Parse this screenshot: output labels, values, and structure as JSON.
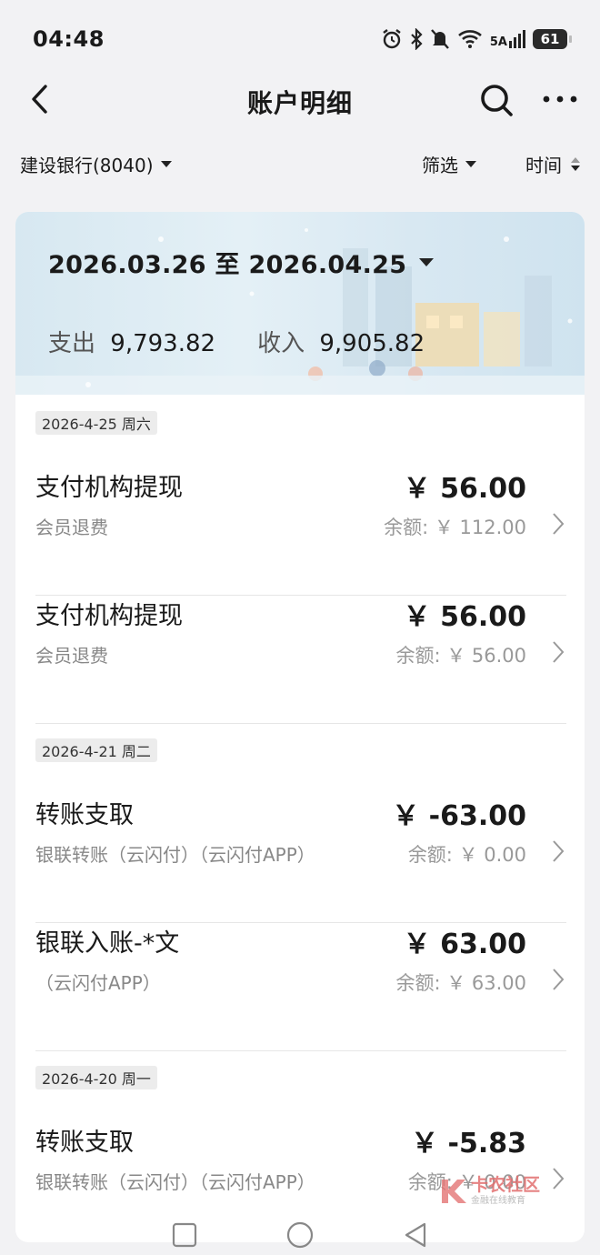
{
  "status_bar": {
    "time": "04:48",
    "signal_label": "5A",
    "battery": "61",
    "icons": [
      "alarm-icon",
      "bluetooth-icon",
      "mute-icon",
      "wifi-icon",
      "cell-signal-icon",
      "battery-icon"
    ]
  },
  "navbar": {
    "title": "账户明细",
    "icons": [
      "back-arrow-icon",
      "search-icon",
      "more-icon"
    ]
  },
  "filters": {
    "account": "建设银行(8040)",
    "filter": "筛选",
    "sort": "时间"
  },
  "summary": {
    "range": "2026.03.26 至 2026.04.25",
    "expense_label": "支出",
    "expense_value": "9,793.82",
    "income_label": "收入",
    "income_value": "9,905.82"
  },
  "groups": [
    {
      "date": "2026-4-25 周六",
      "items": [
        {
          "title": "支付机构提现",
          "desc": "会员退费",
          "amount": "￥ 56.00",
          "balance": "余额: ￥ 112.00"
        },
        {
          "title": "支付机构提现",
          "desc": "会员退费",
          "amount": "￥ 56.00",
          "balance": "余额: ￥ 56.00"
        }
      ]
    },
    {
      "date": "2026-4-21 周二",
      "items": [
        {
          "title": "转账支取",
          "desc": "银联转账（云闪付）（云闪付APP）",
          "amount": "￥ -63.00",
          "balance": "余额: ￥ 0.00"
        },
        {
          "title": "银联入账-*文",
          "desc": "（云闪付APP）",
          "amount": "￥ 63.00",
          "balance": "余额: ￥ 63.00"
        }
      ]
    },
    {
      "date": "2026-4-20 周一",
      "items": [
        {
          "title": "转账支取",
          "desc": "银联转账（云闪付）（云闪付APP）",
          "amount": "￥ -5.83",
          "balance": "余额: ￥ 0.00"
        }
      ]
    }
  ],
  "watermark": {
    "main": "卡农社区",
    "sub": "金融在线教育"
  },
  "system_nav": [
    "recent-apps-icon",
    "home-icon",
    "back-icon"
  ]
}
